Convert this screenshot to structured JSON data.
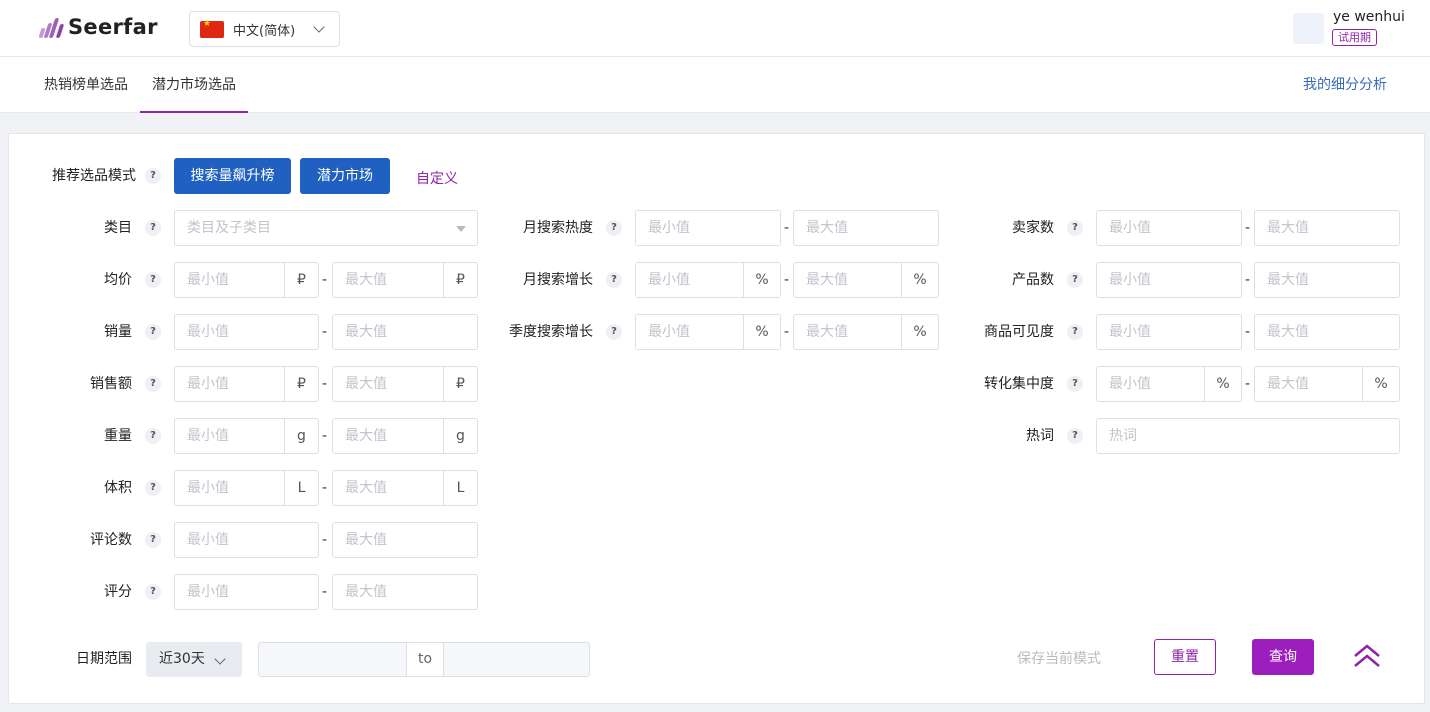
{
  "header": {
    "brand": "Seerfar",
    "language": "中文(简体)",
    "username": "ye wenhui",
    "trial_badge": "试用期"
  },
  "tabs": {
    "items": [
      {
        "label": "热销榜单选品"
      },
      {
        "label": "潜力市场选品"
      }
    ],
    "active_index": 1,
    "right_link": "我的细分分析"
  },
  "mode": {
    "label": "推荐选品模式",
    "buttons": [
      "搜索量飙升榜",
      "潜力市场"
    ],
    "custom": "自定义"
  },
  "placeholders": {
    "min": "最小值",
    "max": "最大值",
    "category": "类目及子类目",
    "hotword": "热词"
  },
  "units": {
    "ruble": "₽",
    "percent": "%",
    "gram": "g",
    "liter": "L"
  },
  "filters": {
    "category": "类目",
    "avg_price": "均价",
    "sales": "销量",
    "revenue": "销售额",
    "weight": "重量",
    "volume": "体积",
    "reviews": "评论数",
    "rating": "评分",
    "monthly_search_heat": "月搜索热度",
    "monthly_search_growth": "月搜索增长",
    "quarterly_search_growth": "季度搜索增长",
    "sellers": "卖家数",
    "products": "产品数",
    "visibility": "商品可见度",
    "conversion_concentration": "转化集中度",
    "hotword": "热词"
  },
  "date": {
    "label": "日期范围",
    "selected": "近30天",
    "to": "to"
  },
  "actions": {
    "save_mode": "保存当前模式",
    "reset": "重置",
    "query": "查询"
  },
  "help_symbol": "?",
  "dash_symbol": "-",
  "colors": {
    "brand_purple": "#8e24aa",
    "primary_blue": "#2060c0",
    "query_purple": "#9c1ebd"
  }
}
